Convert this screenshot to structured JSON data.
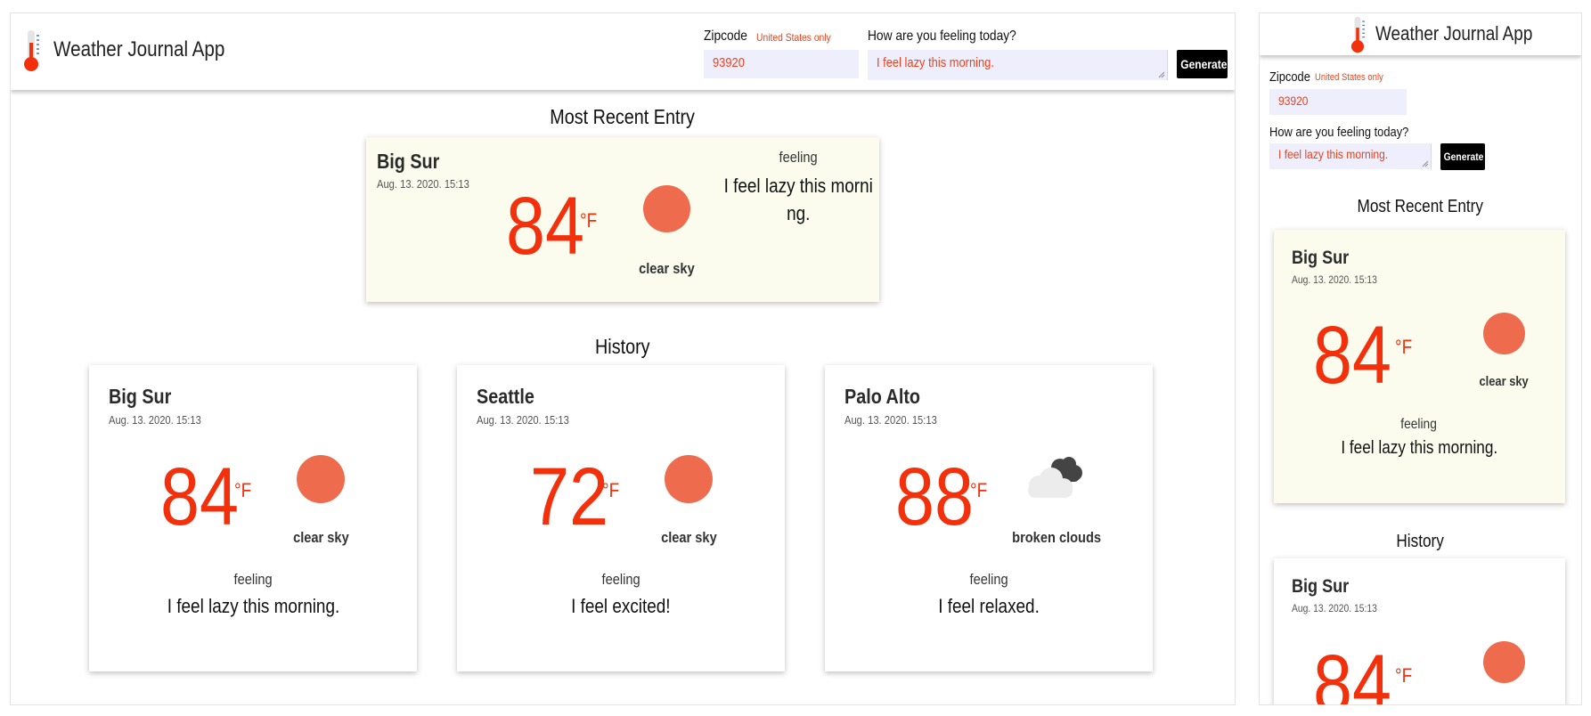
{
  "app": {
    "title": "Weather Journal App"
  },
  "form": {
    "zip_label": "Zipcode",
    "zip_note": "United States only",
    "zip_value": "93920",
    "feeling_label": "How are you feeling today?",
    "feeling_value": "I feel lazy this morning.",
    "generate_label": "Generate"
  },
  "recent": {
    "heading": "Most Recent Entry",
    "city": "Big Sur",
    "date": "Aug. 13. 2020. 15:13",
    "temp": "84",
    "unit": "°F",
    "description": "clear sky",
    "icon": "sun-icon",
    "feeling_label": "feeling",
    "feeling": "I feel lazy this morning.",
    "feeling_wrap_1": "I feel lazy this morni",
    "feeling_wrap_2": "ng."
  },
  "history": {
    "heading": "History",
    "entries": [
      {
        "city": "Big Sur",
        "date": "Aug. 13. 2020. 15:13",
        "temp": "84",
        "unit": "°F",
        "description": "clear sky",
        "icon": "sun-icon",
        "feeling_label": "feeling",
        "feeling": "I feel lazy this morning."
      },
      {
        "city": "Seattle",
        "date": "Aug. 13. 2020. 15:13",
        "temp": "72",
        "unit": "°F",
        "description": "clear sky",
        "icon": "sun-icon",
        "feeling_label": "feeling",
        "feeling": "I feel excited!"
      },
      {
        "city": "Palo Alto",
        "date": "Aug. 13. 2020. 15:13",
        "temp": "88",
        "unit": "°F",
        "description": "broken clouds",
        "icon": "broken-clouds-icon",
        "feeling_label": "feeling",
        "feeling": "I feel relaxed."
      }
    ]
  },
  "colors": {
    "accent": "#f3300c",
    "sun": "#ee6b4d",
    "input_bg": "#eeeefc",
    "recent_card_bg": "#fbfcee"
  }
}
